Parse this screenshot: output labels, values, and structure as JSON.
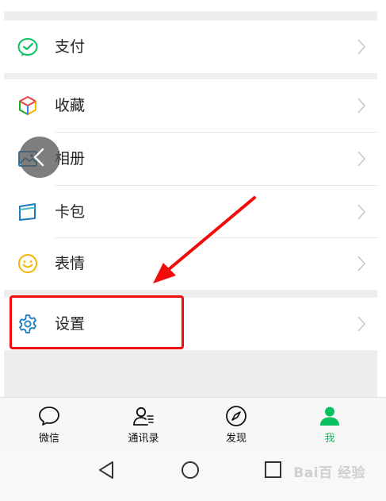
{
  "menu": {
    "pay": "支付",
    "favorites": "收藏",
    "album": "相册",
    "cards": "卡包",
    "stickers": "表情",
    "settings": "设置"
  },
  "tabs": [
    {
      "label": "微信"
    },
    {
      "label": "通讯录"
    },
    {
      "label": "发现"
    },
    {
      "label": "我"
    }
  ],
  "watermark": "Bai百 经验",
  "colors": {
    "accent_green": "#07c160",
    "annotation_red": "#f20c0c",
    "icon_blue": "#1a7bbd"
  }
}
